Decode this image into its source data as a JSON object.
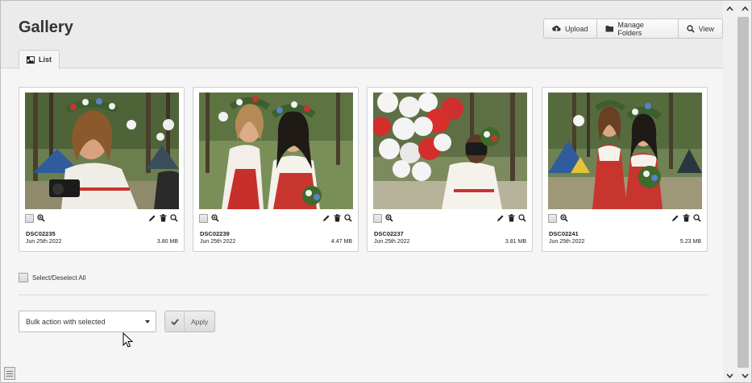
{
  "header": {
    "title": "Gallery",
    "buttons": {
      "upload": "Upload",
      "manage_folders": "Manage Folders",
      "view": "View"
    }
  },
  "tabs": [
    {
      "label": "List",
      "icon": "image-icon",
      "active": true
    }
  ],
  "gallery": {
    "items": [
      {
        "name": "DSC02235",
        "date": "Jun 25th 2022",
        "size": "3.80 MB",
        "icon_left": [
          "checkbox",
          "zoom-in-icon"
        ],
        "icons_right": [
          "edit-icon",
          "trash-icon",
          "search-icon"
        ]
      },
      {
        "name": "DSC02239",
        "date": "Jun 25th 2022",
        "size": "4.47 MB",
        "icon_left": [
          "checkbox",
          "zoom-in-icon"
        ],
        "icons_right": [
          "edit-icon",
          "trash-icon",
          "search-icon"
        ]
      },
      {
        "name": "DSC02237",
        "date": "Jun 25th 2022",
        "size": "3.81 MB",
        "icon_left": [
          "checkbox",
          "zoom-in-icon"
        ],
        "icons_right": [
          "edit-icon",
          "trash-icon",
          "search-icon"
        ]
      },
      {
        "name": "DSC02241",
        "date": "Jun 25th 2022",
        "size": "5.23 MB",
        "icon_left": [
          "checkbox",
          "zoom-in-icon"
        ],
        "icons_right": [
          "edit-icon",
          "trash-icon",
          "search-icon"
        ]
      }
    ],
    "select_all_label": "Select/Deselect All"
  },
  "bulk": {
    "selected_value": "Bulk action with selected",
    "apply_label": "Apply"
  },
  "colors": {
    "background": "#f5f5f5",
    "header_bg": "#ebebeb",
    "scroll_thumb": "#c1c1c1"
  }
}
